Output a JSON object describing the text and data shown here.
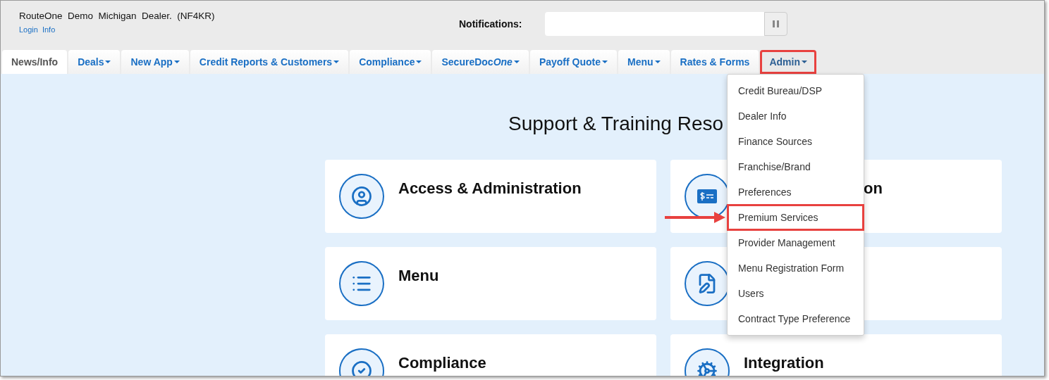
{
  "header": {
    "dealer": "RouteOne  Demo  Michigan  Dealer.  (NF4KR)",
    "links": [
      "Login",
      "Info"
    ],
    "notifications": {
      "label": "Notifications:"
    }
  },
  "tabs": [
    {
      "label": "News/Info",
      "caret": false,
      "selected": true,
      "annotated": false
    },
    {
      "label": "Deals",
      "caret": true,
      "selected": false,
      "annotated": false
    },
    {
      "label": "New App",
      "caret": true,
      "selected": false,
      "annotated": false
    },
    {
      "label": "Credit Reports & Customers",
      "caret": true,
      "selected": false,
      "annotated": false
    },
    {
      "label": "Compliance",
      "caret": true,
      "selected": false,
      "annotated": false
    },
    {
      "label": "SecureDoc",
      "label_italic": "One",
      "caret": true,
      "selected": false,
      "annotated": false
    },
    {
      "label": "Payoff Quote",
      "caret": true,
      "selected": false,
      "annotated": false
    },
    {
      "label": "Menu",
      "caret": true,
      "selected": false,
      "annotated": false
    },
    {
      "label": "Rates & Forms",
      "caret": false,
      "selected": false,
      "annotated": false
    },
    {
      "label": "Admin",
      "caret": true,
      "selected": false,
      "annotated": true
    }
  ],
  "page_title": "Support & Training Reso",
  "cards": [
    {
      "kind": "titled",
      "title": "Access & Administration"
    },
    {
      "kind": "titled",
      "title": "on"
    },
    {
      "kind": "titled",
      "title": "Menu"
    },
    {
      "kind": "untitled"
    },
    {
      "kind": "titled",
      "title": "Compliance"
    },
    {
      "kind": "titled",
      "title": "Integration"
    }
  ],
  "admin_menu": {
    "items": [
      {
        "label": "Credit Bureau/DSP",
        "annotated": false
      },
      {
        "label": "Dealer Info",
        "annotated": false
      },
      {
        "label": "Finance Sources",
        "annotated": false
      },
      {
        "label": "Franchise/Brand",
        "annotated": false
      },
      {
        "label": "Preferences",
        "annotated": false
      },
      {
        "label": "Premium Services",
        "annotated": true
      },
      {
        "label": "Provider Management",
        "annotated": false
      },
      {
        "label": "Menu Registration Form",
        "annotated": false
      },
      {
        "label": "Users",
        "annotated": false
      },
      {
        "label": "Contract Type Preference",
        "annotated": false
      }
    ]
  }
}
